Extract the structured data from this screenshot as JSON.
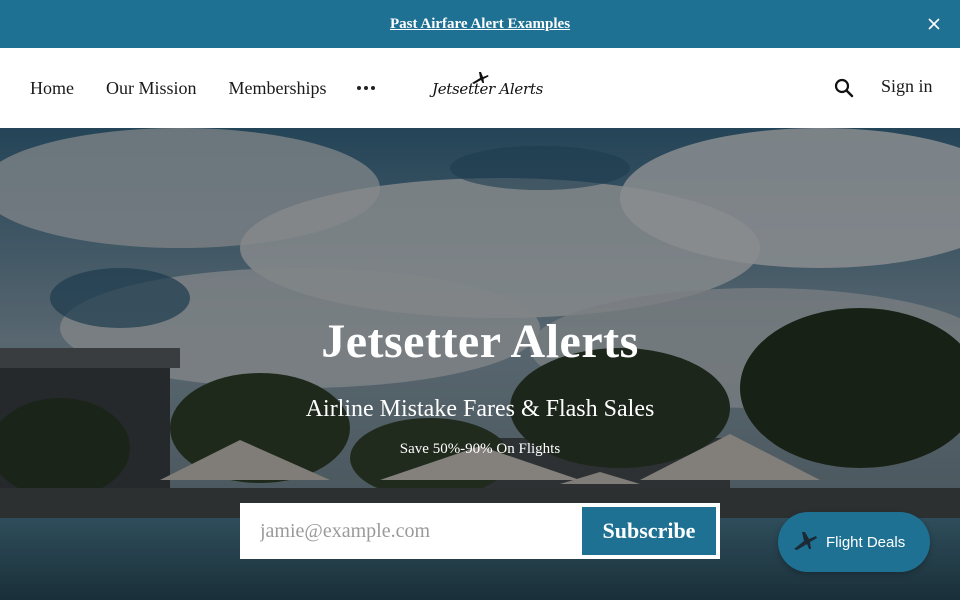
{
  "announcement": {
    "link_text": "Past Airfare Alert Examples",
    "close_icon": "close-icon"
  },
  "nav": {
    "items": [
      {
        "label": "Home"
      },
      {
        "label": "Our Mission"
      },
      {
        "label": "Memberships"
      }
    ],
    "more_icon": "more-dots-icon",
    "logo_text": "Jetsetter Alerts",
    "search_icon": "search-icon",
    "signin_label": "Sign in"
  },
  "hero": {
    "title": "Jetsetter Alerts",
    "subtitle": "Airline Mistake Fares & Flash Sales",
    "tagline": "Save 50%-90% On Flights",
    "email_placeholder": "jamie@example.com",
    "subscribe_label": "Subscribe"
  },
  "floating_button": {
    "label": "Flight Deals",
    "icon": "airplane-icon"
  },
  "colors": {
    "accent": "#1e7193",
    "nav_text": "#1a1a1a",
    "hero_text": "#ffffff"
  }
}
